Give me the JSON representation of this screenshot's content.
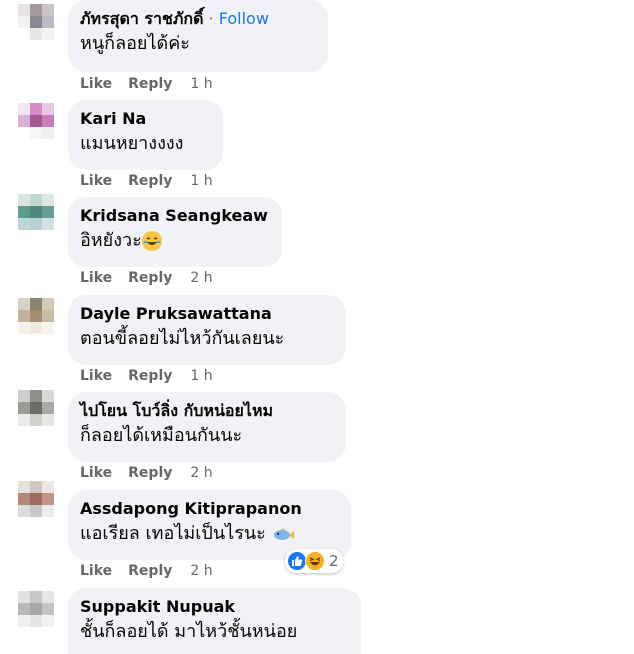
{
  "actions": {
    "like": "Like",
    "reply": "Reply"
  },
  "comments": [
    {
      "name": "ภัทรสุดา ราชภักดิ์",
      "dot": " · ",
      "follow": "Follow",
      "text": "หนูก็ลอยได้ค่ะ",
      "time": "1 h"
    },
    {
      "name": "Kari Na",
      "text": "แมนหยางงงง",
      "time": "1 h"
    },
    {
      "name": "Kridsana Seangkeaw",
      "text": "อิหยังวะ",
      "emoji": "laughing-with-tears-emoji",
      "time": "2 h"
    },
    {
      "name": "Dayle Pruksawattana",
      "text": "ตอนขี้ลอยไม่ไหว้กันเลยนะ",
      "time": "1 h"
    },
    {
      "name": "ไปโยน โบว์ลิ่ง กับหน่อยไหม",
      "text": "ก็ลอยได้เหมือนกันนะ",
      "time": "2 h"
    },
    {
      "name": "Assdapong Kitiprapanon",
      "text": "แอเรียล เทอไม่เป็นไรนะ ",
      "emoji": "fish-emoji",
      "time": "2 h",
      "reactions": {
        "icons": [
          "like-reaction-icon",
          "haha-reaction-icon"
        ],
        "count": "2"
      }
    },
    {
      "name": "Suppakit Nupuak",
      "text": "ชั้นก็ลอยได้ มาไหว้ชั้นหน่อย"
    }
  ],
  "colors": {
    "bubble": "#f0f2f5",
    "secondary_text": "#65676b",
    "link": "#1877f2",
    "text": "#050505"
  }
}
